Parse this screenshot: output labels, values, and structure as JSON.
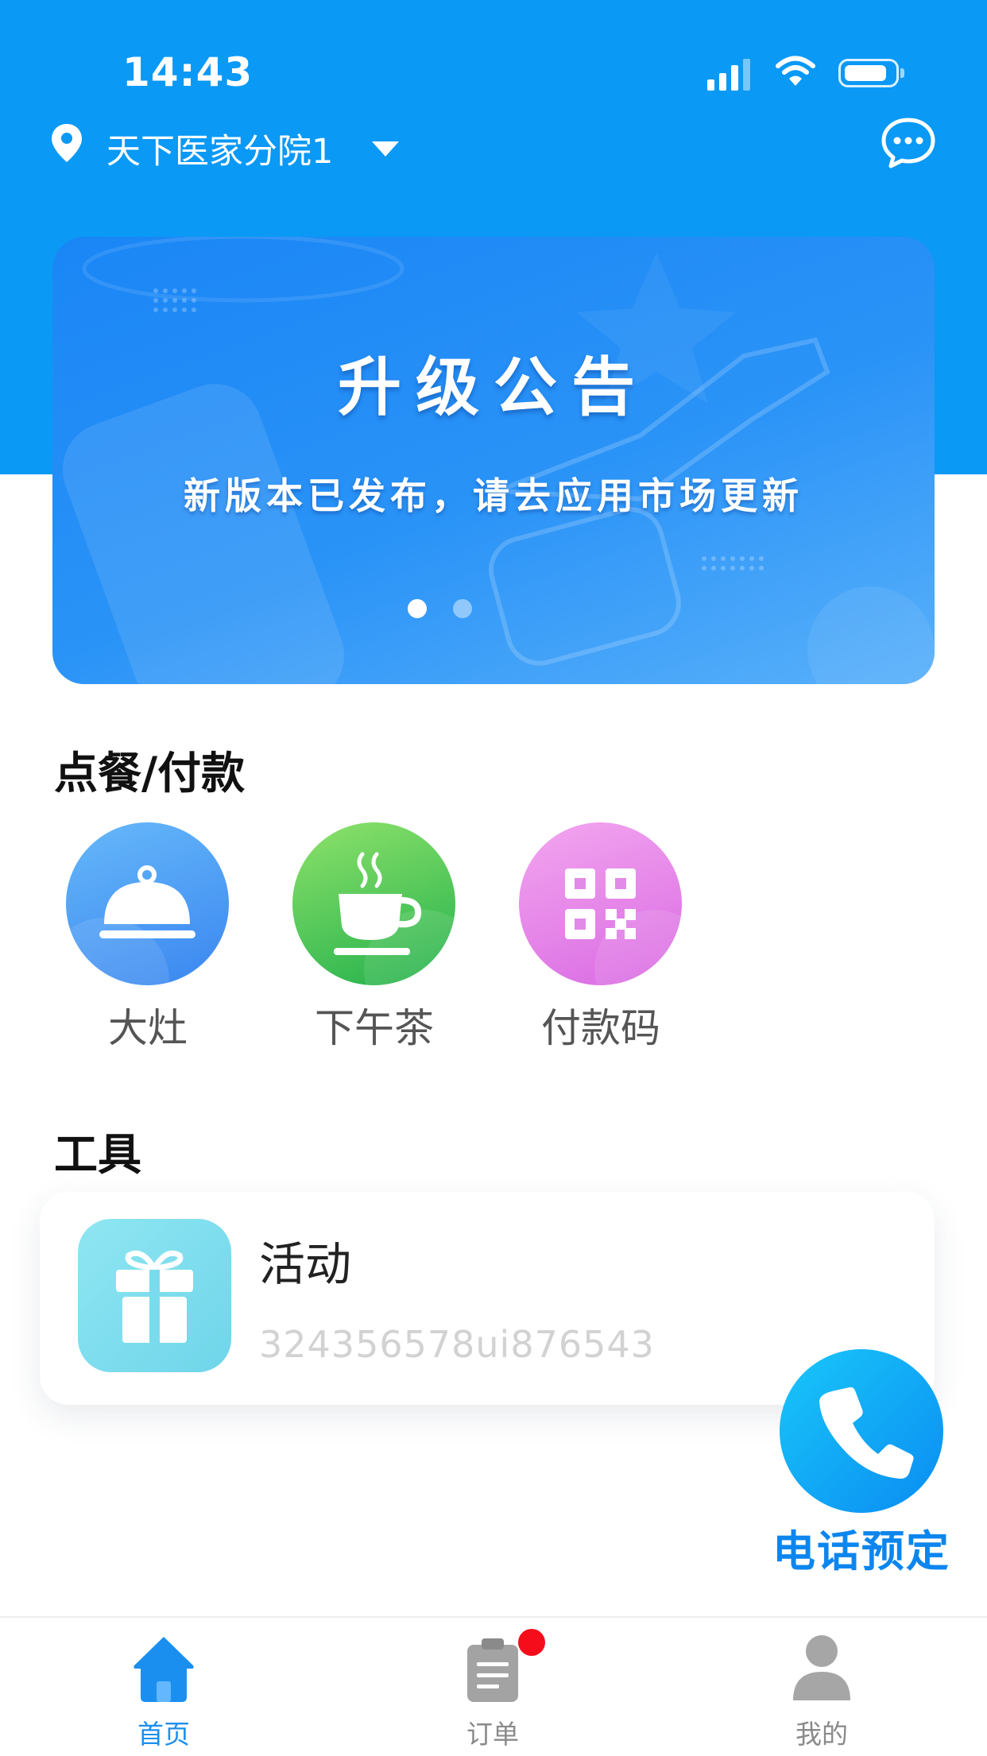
{
  "status_bar": {
    "time": "14:43"
  },
  "header": {
    "location": "天下医家分院1"
  },
  "banner": {
    "title": "升级公告",
    "subtitle": "新版本已发布，请去应用市场更新",
    "page_count": 2,
    "active_page": 1
  },
  "ordering": {
    "title": "点餐/付款",
    "items": [
      {
        "label": "大灶",
        "icon": "serving-cloche-icon"
      },
      {
        "label": "下午茶",
        "icon": "coffee-cup-icon"
      },
      {
        "label": "付款码",
        "icon": "qr-code-icon"
      }
    ]
  },
  "tools": {
    "title": "工具",
    "items": [
      {
        "title": "活动",
        "subtitle": "324356578ui876543",
        "icon": "gift-icon"
      }
    ]
  },
  "call": {
    "label": "电话预定",
    "icon": "phone-icon"
  },
  "tabbar": {
    "items": [
      {
        "label": "首页",
        "icon": "home-icon",
        "active": true
      },
      {
        "label": "订单",
        "icon": "clipboard-icon",
        "badge": true
      },
      {
        "label": "我的",
        "icon": "person-icon"
      }
    ]
  },
  "colors": {
    "primary": "#0a99f5",
    "accent_text": "#0c86ee",
    "tab_active": "#1a8ff0",
    "tab_inactive": "#9a9a9a",
    "badge": "#f50d1c"
  }
}
